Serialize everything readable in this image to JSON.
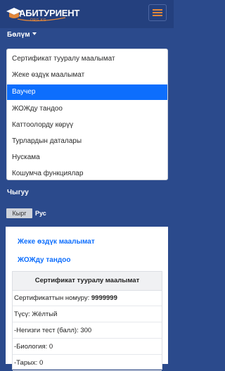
{
  "brand": {
    "name": "АБИТУРИЕНТ",
    "tagline": "ORG.KG"
  },
  "colors": {
    "navbar": "#24407e",
    "background": "#2b4a8c",
    "accent": "#e2873a",
    "active_item": "#0d6efd",
    "link": "#0d6efd"
  },
  "nav": {
    "section_label": "Бөлүм",
    "dropdown_items": [
      "Сертификат тууралу маалымат",
      "Жеке өздүк маалымат",
      "Ваучер",
      "ЖОЖду тандоо",
      "Каттоолорду көрүү",
      "Турлардын даталары",
      "Нускама",
      "Кошумча функциялар"
    ],
    "active_item": "Ваучер",
    "logout_label": "Чыгуу",
    "languages": {
      "ky": "Кырг",
      "ru": "Рус"
    }
  },
  "content": {
    "links": [
      "Жеке өздүк маалымат",
      "ЖОЖду тандоо"
    ],
    "card": {
      "title": "Сертификат тууралу маалымат",
      "certificate_label": "Сертификаттын номуру:",
      "certificate_number": "9999999",
      "type_text": "Түсү: Жёлтый",
      "rows": [
        "-Негизги тест (балл): 300",
        "-Биология: 0",
        "-Тарых: 0"
      ]
    }
  }
}
